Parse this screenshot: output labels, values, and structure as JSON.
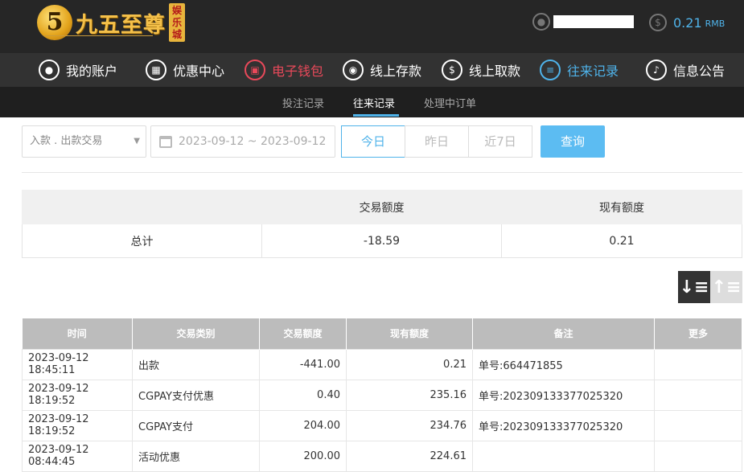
{
  "brand": {
    "logo_mark": "5",
    "name": "九五至尊",
    "badge": "娱乐城"
  },
  "user": {
    "username": "●●●●●●",
    "balance": "0.21",
    "currency": "RMB"
  },
  "nav": [
    {
      "label": "我的账户",
      "icon": "user-icon"
    },
    {
      "label": "优惠中心",
      "icon": "gift-icon"
    },
    {
      "label": "电子钱包",
      "icon": "wallet-icon"
    },
    {
      "label": "线上存款",
      "icon": "deposit-icon"
    },
    {
      "label": "线上取款",
      "icon": "withdraw-icon"
    },
    {
      "label": "往来记录",
      "icon": "records-icon"
    },
    {
      "label": "信息公告",
      "icon": "bell-icon"
    }
  ],
  "subnav": [
    {
      "label": "投注记录"
    },
    {
      "label": "往来记录"
    },
    {
      "label": "处理中订单"
    }
  ],
  "filters": {
    "type_select": "入款 . 出款交易",
    "date_range": "2023-09-12 ~ 2023-09-12",
    "quick": [
      {
        "label": "今日"
      },
      {
        "label": "昨日"
      },
      {
        "label": "近7日"
      }
    ],
    "query_label": "查询"
  },
  "summary": {
    "headers": [
      "",
      "交易额度",
      "现有额度"
    ],
    "row": {
      "label": "总计",
      "amount": "-18.59",
      "balance": "0.21"
    }
  },
  "table": {
    "headers": [
      "时间",
      "交易类别",
      "交易额度",
      "现有额度",
      "备注",
      "更多"
    ],
    "rows": [
      {
        "time": "2023-09-12 18:45:11",
        "type": "出款",
        "amount": "-441.00",
        "balance": "0.21",
        "note": "单号:664471855"
      },
      {
        "time": "2023-09-12 18:19:52",
        "type": "CGPAY支付优惠",
        "amount": "0.40",
        "balance": "235.16",
        "note": "单号:202309133377025320"
      },
      {
        "time": "2023-09-12 18:19:52",
        "type": "CGPAY支付",
        "amount": "204.00",
        "balance": "234.76",
        "note": "单号:202309133377025320"
      },
      {
        "time": "2023-09-12 08:44:45",
        "type": "活动优惠",
        "amount": "200.00",
        "balance": "224.61",
        "note": ""
      }
    ]
  },
  "colors": {
    "accent": "#4fb3ea",
    "wallet_red": "#e8495a",
    "header_bg": "#262626"
  }
}
